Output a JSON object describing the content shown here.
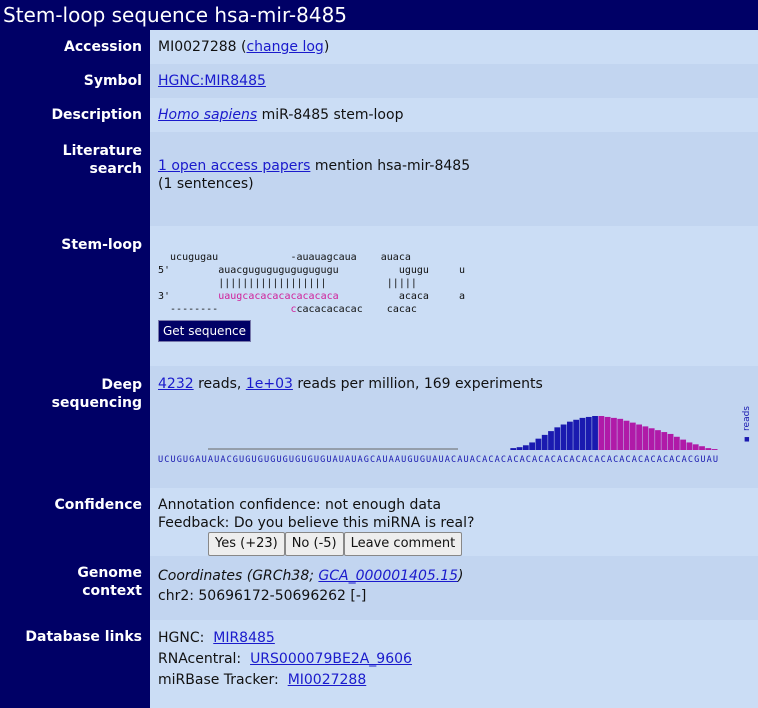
{
  "title": "Stem-loop sequence hsa-mir-8485",
  "accession": {
    "label": "Accession",
    "value": "MI0027288",
    "link": "change log"
  },
  "symbol": {
    "label": "Symbol",
    "link": "HGNC:MIR8485"
  },
  "description": {
    "label": "Description",
    "species": "Homo sapiens",
    "text": "miR-8485 stem-loop"
  },
  "literature": {
    "label1": "Literature",
    "label2": "search",
    "link": "1 open access papers",
    "text": "mention hsa-mir-8485",
    "sentences": "(1 sentences)"
  },
  "stemloop": {
    "label": "Stem-loop",
    "lines": [
      "  ucugugau            -auauagcaua    auaca",
      "5'        auacgugugugugugugugu          ugugu     u",
      "          ||||||||||||||||||          |||||",
      "3'        ",
      "  --------            ",
      "uaugcacacacacacacaca",
      "          acaca     a",
      "cacacacacac    cacac"
    ],
    "button": "Get sequence"
  },
  "deep": {
    "label1": "Deep",
    "label2": "sequencing",
    "reads": "4232",
    "reads_text": "reads,",
    "rpm": "1e+03",
    "rpm_text": "reads per million, 169 experiments",
    "legend": "reads",
    "sequence": "UCUGUGAUAUACGUGUGUGUGUGUGUGUAUAUAGCAUAAUGUGUAUACAUACACACACACACACACACACACACACACACACACACGUAU",
    "bars": [
      0,
      0,
      0,
      0,
      0,
      0,
      0,
      0,
      0,
      0,
      0,
      0,
      0,
      0,
      0,
      0,
      0,
      0,
      0,
      0,
      0,
      0,
      0,
      0,
      0,
      0,
      0,
      0,
      0,
      0,
      0,
      0,
      0,
      0,
      0,
      0,
      0,
      0,
      0,
      0,
      0,
      0,
      0,
      0,
      0,
      0,
      0,
      0,
      0,
      0,
      0,
      0,
      0,
      0,
      0,
      0,
      2,
      3,
      5,
      8,
      12,
      16,
      20,
      24,
      27,
      30,
      32,
      34,
      35,
      36,
      36,
      35,
      34,
      33,
      31,
      29,
      27,
      25,
      23,
      21,
      19,
      17,
      14,
      11,
      8,
      6,
      4,
      2,
      1
    ],
    "bar_colors": [
      "#1a1ab0",
      "#b01aa8"
    ]
  },
  "confidence": {
    "label": "Confidence",
    "line1": "Annotation confidence: not enough data",
    "line2": "Feedback: Do you believe this miRNA is real?",
    "yes": "Yes (+23)",
    "no": "No (-5)",
    "comment": "Leave comment"
  },
  "genome": {
    "label1": "Genome",
    "label2": "context",
    "coord_prefix": "Coordinates (GRCh38; ",
    "coord_link": "GCA_000001405.15",
    "coord_suffix": ")",
    "location": "chr2: 50696172-50696262 [-]"
  },
  "dblinks": {
    "label": "Database links",
    "items": [
      {
        "name": "HGNC:",
        "link": "MIR8485"
      },
      {
        "name": "RNAcentral:",
        "link": "URS000079BE2A_9606"
      },
      {
        "name": "miRBase Tracker:",
        "link": "MI0027288"
      }
    ]
  }
}
